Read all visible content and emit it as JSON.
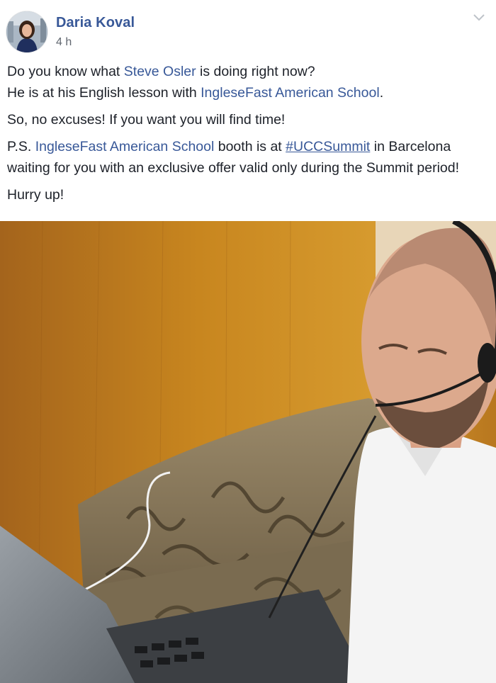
{
  "post": {
    "author": {
      "name": "Daria Koval",
      "avatar": "profile-photo"
    },
    "timestamp": "4 h",
    "menu_icon": "chevron-down-icon",
    "paragraphs": {
      "p1": {
        "s1": "Do you know what ",
        "mention1": "Steve Osler",
        "s2": " is doing right now?",
        "s3": "He is at his English lesson with ",
        "page1": "IngleseFast American School",
        "s4": "."
      },
      "p2": {
        "text": "So, no excuses! If you want you will find time!"
      },
      "p3": {
        "s1": "P.S. ",
        "page": "IngleseFast American School",
        "s2": " booth is at ",
        "hashtag": "#UCCSummit",
        "s3": " in Barcelona waiting for you with an exclusive offer valid only during the Summit period!"
      },
      "p4": {
        "text": "Hurry up!"
      }
    },
    "photo": {
      "subject": "man-with-headset-at-laptop"
    }
  }
}
